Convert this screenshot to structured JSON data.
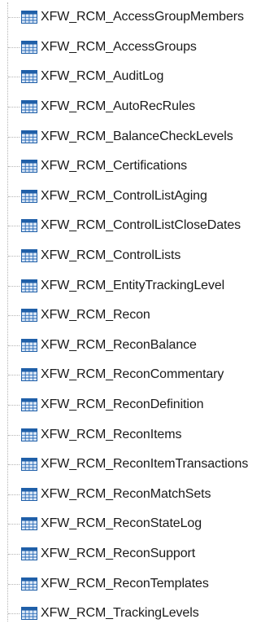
{
  "tree": {
    "icon": "table-icon",
    "colors": {
      "icon_header": "#1f5fa8",
      "icon_grid": "#2b6cb8",
      "icon_cell": "#dfeaf7",
      "guide_line": "#b4b4b4",
      "text": "#1a1a1a"
    },
    "items": [
      {
        "label": "XFW_RCM_AccessGroupMembers"
      },
      {
        "label": "XFW_RCM_AccessGroups"
      },
      {
        "label": "XFW_RCM_AuditLog"
      },
      {
        "label": "XFW_RCM_AutoRecRules"
      },
      {
        "label": "XFW_RCM_BalanceCheckLevels"
      },
      {
        "label": "XFW_RCM_Certifications"
      },
      {
        "label": "XFW_RCM_ControlListAging"
      },
      {
        "label": "XFW_RCM_ControlListCloseDates"
      },
      {
        "label": "XFW_RCM_ControlLists"
      },
      {
        "label": "XFW_RCM_EntityTrackingLevel"
      },
      {
        "label": "XFW_RCM_Recon"
      },
      {
        "label": "XFW_RCM_ReconBalance"
      },
      {
        "label": "XFW_RCM_ReconCommentary"
      },
      {
        "label": "XFW_RCM_ReconDefinition"
      },
      {
        "label": "XFW_RCM_ReconItems"
      },
      {
        "label": "XFW_RCM_ReconItemTransactions"
      },
      {
        "label": "XFW_RCM_ReconMatchSets"
      },
      {
        "label": "XFW_RCM_ReconStateLog"
      },
      {
        "label": "XFW_RCM_ReconSupport"
      },
      {
        "label": "XFW_RCM_ReconTemplates"
      },
      {
        "label": "XFW_RCM_TrackingLevels"
      }
    ]
  }
}
